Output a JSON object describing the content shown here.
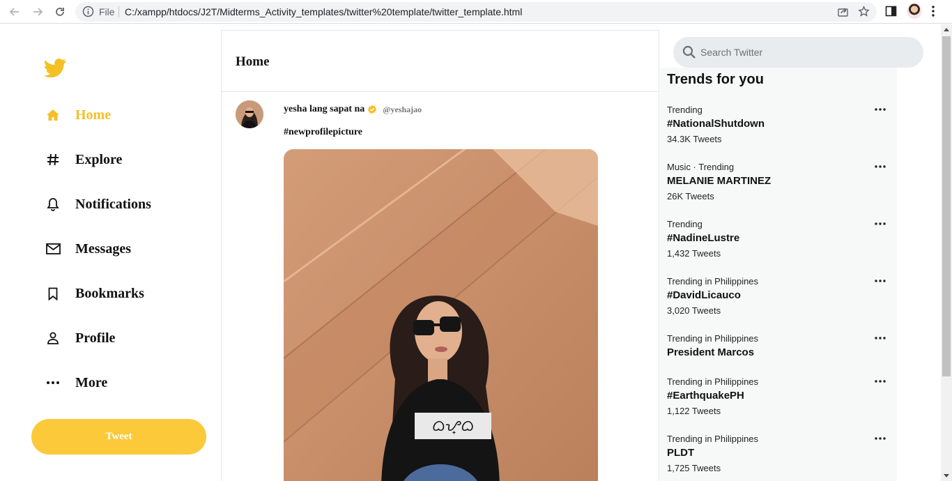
{
  "browser": {
    "file_label": "File",
    "url": "C:/xampp/htdocs/J2T/Midterms_Activity_templates/twitter%20template/twitter_template.html"
  },
  "colors": {
    "accent": "#f4c026",
    "tweet_button": "#fbc93a"
  },
  "sidebar": {
    "items": [
      {
        "label": "Home",
        "icon": "home-icon",
        "active": true
      },
      {
        "label": "Explore",
        "icon": "hashtag-icon"
      },
      {
        "label": "Notifications",
        "icon": "bell-icon"
      },
      {
        "label": "Messages",
        "icon": "mail-icon"
      },
      {
        "label": "Bookmarks",
        "icon": "bookmark-icon"
      },
      {
        "label": "Profile",
        "icon": "person-icon"
      },
      {
        "label": "More",
        "icon": "more-dots-icon"
      }
    ],
    "tweet_button": "Tweet"
  },
  "main": {
    "title": "Home",
    "post": {
      "name": "yesha lang sapat na",
      "handle": "@yeshajao",
      "text": "#newprofilepicture"
    }
  },
  "search": {
    "placeholder": "Search Twitter"
  },
  "trends": {
    "title": "Trends for you",
    "items": [
      {
        "category": "Trending",
        "name": "#NationalShutdown",
        "count": "34.3K Tweets"
      },
      {
        "category": "Music · Trending",
        "name": "MELANIE MARTINEZ",
        "count": "26K Tweets"
      },
      {
        "category": "Trending",
        "name": "#NadineLustre",
        "count": "1,432 Tweets"
      },
      {
        "category": "Trending in Philippines",
        "name": "#DavidLicauco",
        "count": "3,020 Tweets"
      },
      {
        "category": "Trending in Philippines",
        "name": "President Marcos",
        "count": ""
      },
      {
        "category": "Trending in Philippines",
        "name": "#EarthquakePH",
        "count": "1,122 Tweets"
      },
      {
        "category": "Trending in Philippines",
        "name": "PLDT",
        "count": "1,725 Tweets"
      }
    ]
  }
}
